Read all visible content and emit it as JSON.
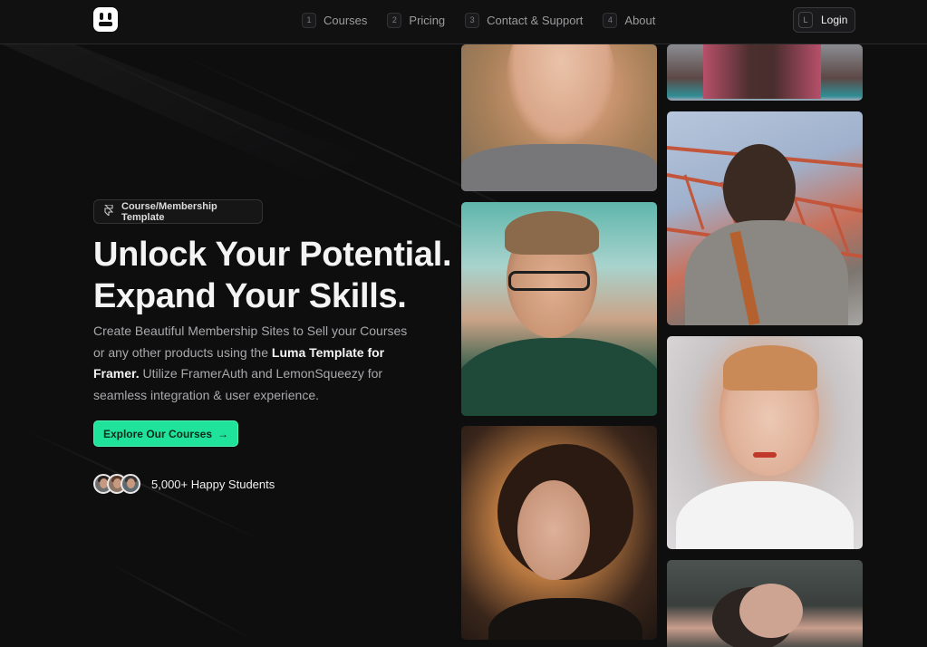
{
  "nav": {
    "items": [
      {
        "num": "1",
        "label": "Courses"
      },
      {
        "num": "2",
        "label": "Pricing"
      },
      {
        "num": "3",
        "label": "Contact & Support"
      },
      {
        "num": "4",
        "label": "About"
      }
    ],
    "login_key": "L",
    "login_label": "Login"
  },
  "hero": {
    "badge_icon": "framer-icon",
    "badge_label": "Course/Membership Template",
    "title_line1": "Unlock Your Potential.",
    "title_line2": "Expand Your Skills.",
    "desc_part1": "Create Beautiful Membership Sites to Sell your Courses or any other products using the ",
    "desc_bold": "Luma Template for Framer.",
    "desc_part2": " Utilize FramerAuth and LemonSqueezy for seamless integration & user experience.",
    "cta_label": "Explore Our Courses",
    "cta_arrow": "→",
    "students_label": "5,000+ Happy Students"
  },
  "colors": {
    "background": "#0e0e0f",
    "accent": "#1fe39a"
  }
}
